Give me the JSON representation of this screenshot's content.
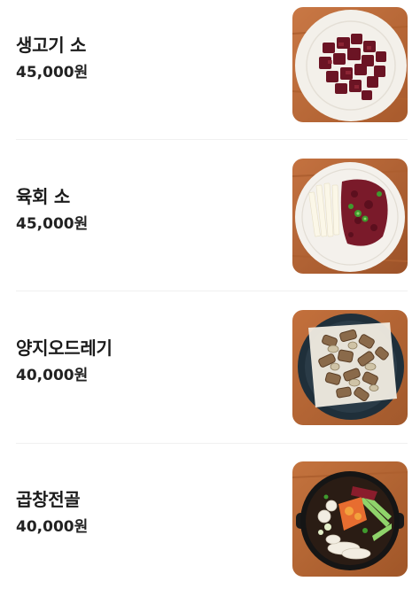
{
  "menu": {
    "items": [
      {
        "name": "생고기 소",
        "price": "45,000원",
        "photo": "raw-beef-cubes-plate"
      },
      {
        "name": "육회 소",
        "price": "45,000원",
        "photo": "beef-tartare-plate"
      },
      {
        "name": "양지오드레기",
        "price": "40,000원",
        "photo": "brisket-odregi-plate"
      },
      {
        "name": "곱창전골",
        "price": "40,000원",
        "photo": "gopchang-hotpot"
      }
    ]
  },
  "colors": {
    "wood": "#b86a3a",
    "plate": "#f4f1ec",
    "meat": "#6e1626",
    "text": "#1b1b1b"
  }
}
